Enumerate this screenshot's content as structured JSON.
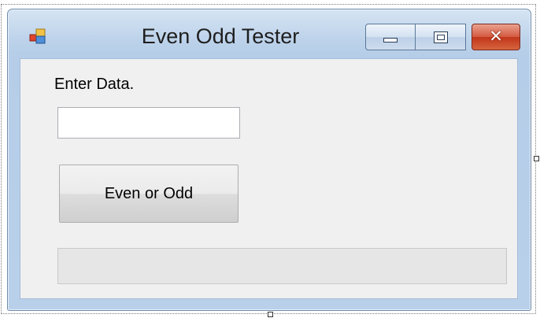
{
  "window": {
    "title": "Even Odd Tester",
    "close_symbol": "✕",
    "icons": {
      "app": "application-icon",
      "minimize": "minimize-icon",
      "maximize": "maximize-icon",
      "close": "close-icon"
    }
  },
  "form": {
    "label": "Enter Data.",
    "input_value": "",
    "button_label": "Even or Odd",
    "result_text": ""
  },
  "colors": {
    "frame": "#b9d0ea",
    "client": "#f0f0f0",
    "close_button": "#c1361b",
    "result_box": "#e6e6e6"
  }
}
